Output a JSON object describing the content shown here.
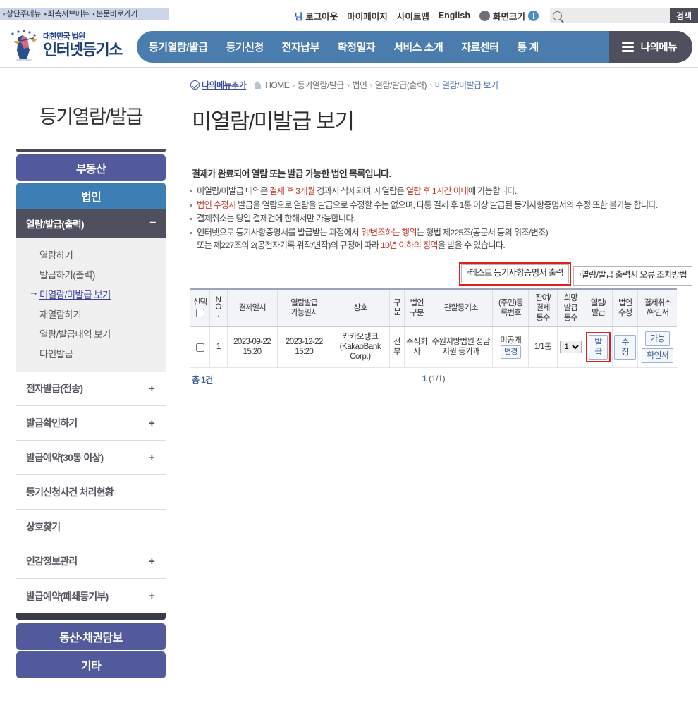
{
  "topbar": {
    "skip_links": [
      "상단주메뉴",
      "좌측서브메뉴",
      "본문바로가기"
    ],
    "user_suffix": "님",
    "links": [
      "로그아웃",
      "마이페이지",
      "사이트맵",
      "English"
    ],
    "zoom_label": "화면크기",
    "zoom_out_icon": "minus-circle-icon",
    "zoom_in_icon": "plus-circle-icon",
    "search_placeholder": "",
    "search_value": "",
    "search_button": "검색",
    "search_icon": "search-icon"
  },
  "header": {
    "logo_line1": "대한민국 법원",
    "logo_line2": "인터넷등기소",
    "logo_icon": "court-scales-logo-icon",
    "gnb": [
      "등기열람/발급",
      "등기신청",
      "전자납부",
      "확정일자",
      "서비스 소개",
      "자료센터",
      "통 계"
    ],
    "mymenu_label": "나의메뉴",
    "mymenu_icon": "hamburger-icon"
  },
  "sidebar": {
    "title": "등기열람/발급",
    "primary_buttons": [
      {
        "label": "부동산",
        "style": "purple"
      },
      {
        "label": "법인",
        "style": "blue"
      }
    ],
    "section": {
      "label": "열람/발급(출력)",
      "toggle": "−"
    },
    "sub_items": [
      {
        "label": "열람하기",
        "active": false
      },
      {
        "label": "발급하기(출력)",
        "active": false
      },
      {
        "label": "미열람/미발급 보기",
        "active": true
      },
      {
        "label": "재열람하기",
        "active": false
      },
      {
        "label": "열람/발급내역 보기",
        "active": false
      },
      {
        "label": "타인발급",
        "active": false
      }
    ],
    "rows": [
      {
        "label": "전자발급(전송)",
        "toggle": "+"
      },
      {
        "label": "발급확인하기",
        "toggle": "+"
      },
      {
        "label": "발급예약(30통 이상)",
        "toggle": "+"
      },
      {
        "label": "등기신청사건 처리현황",
        "toggle": ""
      },
      {
        "label": "상호찾기",
        "toggle": ""
      },
      {
        "label": "인감정보관리",
        "toggle": "+"
      },
      {
        "label": "발급예약(폐쇄등기부)",
        "toggle": "+"
      }
    ],
    "bottom_buttons": [
      {
        "label": "동산·채권담보"
      },
      {
        "label": "기타"
      }
    ]
  },
  "breadcrumb": {
    "add_menu": "나의메뉴추가",
    "add_menu_icon": "check-circle-icon",
    "home_icon": "home-icon",
    "home": "HOME",
    "path": [
      "등기열람/발급",
      "법인",
      "열람/발급(출력)"
    ],
    "current": "미열람/미발급 보기"
  },
  "main": {
    "page_title": "미열람/미발급 보기",
    "lead": "결제가 완료되어 열람 또는 발급 가능한 법인 목록입니다.",
    "notes": [
      [
        {
          "t": "미열람/미발급 내역은 ",
          "c": "n"
        },
        {
          "t": "결제 후 3개월",
          "c": "r"
        },
        {
          "t": " 경과시 삭제되며, 재열람은 ",
          "c": "n"
        },
        {
          "t": "열람 후 1시간 이내",
          "c": "r"
        },
        {
          "t": "에 가능합니다.",
          "c": "n"
        }
      ],
      [
        {
          "t": "법인 수정시",
          "c": "r"
        },
        {
          "t": " 발급을 열람으로 열람을 발급으로 수정할 수는 없으며, 다통 결제 후 1통 이상 발급된 등기사항증명서의 수정 또한 불가능 합니다.",
          "c": "n"
        }
      ],
      [
        {
          "t": "결제취소는 당일 결제건에 한해서만 가능합니다.",
          "c": "n"
        }
      ],
      [
        {
          "t": "인터넷으로 등기사항증명서를 발급받는 과정에서 ",
          "c": "n"
        },
        {
          "t": "위/변조하는 행위",
          "c": "r"
        },
        {
          "t": "는 형법 제225조(공문서 등의 위조/변조)",
          "c": "n"
        },
        {
          "t": "\n또는 제227조의 2(공전자기록 위작/변작)의 규정에 따라 ",
          "c": "n"
        },
        {
          "t": "10년 이하의 징역",
          "c": "r"
        },
        {
          "t": "을 받을 수 있습니다.",
          "c": "n"
        }
      ]
    ],
    "action_buttons": [
      {
        "label": "테스트 등기사항증명서 출력",
        "star": "*",
        "highlight": true
      },
      {
        "label": "열람/발급 출력시 오류 조치방법",
        "star": "*",
        "highlight": false
      }
    ],
    "table": {
      "headers": [
        "선택",
        "NO.",
        "결제일시",
        "열람발급\n가능일시",
        "상호",
        "구분",
        "법인\n구분",
        "관할등기소",
        "(주민)등\n록번호",
        "잔여/\n결제\n통수",
        "희망\n발급\n통수",
        "열람/\n발급",
        "법인\n수정",
        "결제취소\n/확인서"
      ],
      "rows": [
        {
          "no": "1",
          "pay_datetime": "2023-09-22 15:20",
          "avail_datetime": "2023-12-22 15:20",
          "company": "카카오뱅크 (KakaoBank Corp.)",
          "gubun": "전부",
          "corp_type": "주식회사",
          "office": "수원지방법원 성남지원 등기과",
          "reg_no": "미공개",
          "reg_no_button": "변경",
          "remaining": "1/1통",
          "qty_selected": "1",
          "qty_options": [
            "1"
          ],
          "issue_button": "발급",
          "issue_highlight": true,
          "edit_button": "수정",
          "cancel_button": "가능",
          "confirm_button": "확인서"
        }
      ],
      "total_label": "총 1건",
      "page_current": "1",
      "page_info": "(1/1)"
    }
  },
  "colors": {
    "gnb_blue": "#4a7dad",
    "mymenu_dark": "#4f4f5e",
    "sidebar_purple": "#525a9c",
    "sidebar_blue": "#3d7fb5",
    "accent_red": "#e02020",
    "note_red": "#c0392b",
    "link_blue": "#3a6ea5"
  }
}
